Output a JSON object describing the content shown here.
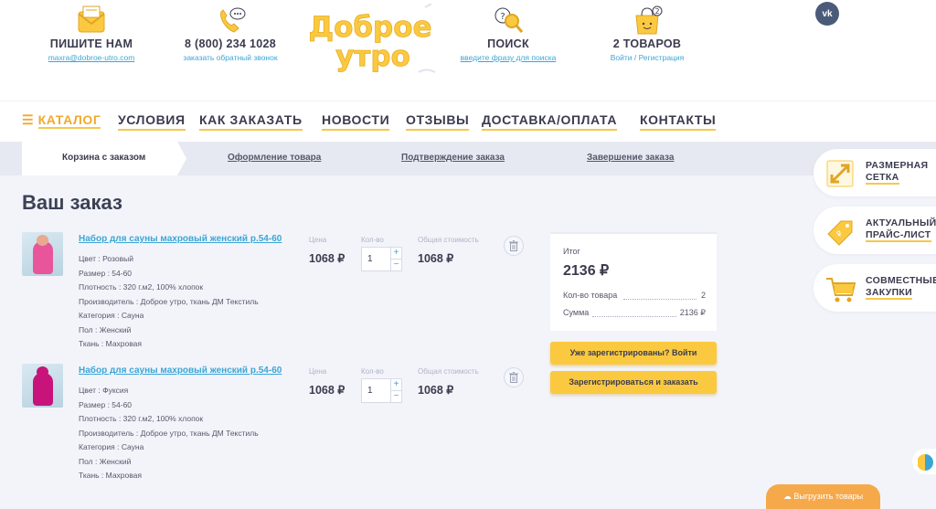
{
  "header": {
    "write": {
      "title": "ПИШИТЕ НАМ",
      "sub": "maxra@dobroe-utro.com",
      "icon": "envelope-icon"
    },
    "phone": {
      "title": "8 (800) 234 1028",
      "sub": "заказать обратный звонок",
      "icon": "phone-icon"
    },
    "logo": {
      "line1": "Доброе",
      "line2": "утро"
    },
    "search": {
      "title": "ПОИСК",
      "sub": "введите фразу для поиска",
      "icon": "search-icon"
    },
    "cart": {
      "title": "2 ТОВАРОВ",
      "sub": "Войти / Регистрация",
      "badge": "2",
      "icon": "cart-bag-icon"
    },
    "vk": "vk"
  },
  "nav": {
    "catalog": "КАТАЛОГ",
    "items": [
      "УСЛОВИЯ",
      "КАК ЗАКАЗАТЬ",
      "НОВОСТИ",
      "ОТЗЫВЫ",
      "ДОСТАВКА/ОПЛАТА",
      "КОНТАКТЫ"
    ]
  },
  "steps": [
    "Корзина с заказом",
    "Оформление товара",
    "Подтверждение заказа",
    "Завершение заказа"
  ],
  "page_title": "Ваш заказ",
  "columns": {
    "price": "Цена",
    "qty": "Кол-во",
    "total": "Общая стоимость"
  },
  "items": [
    {
      "name": "Набор для сауны махровый женский р.54-60",
      "props": [
        "Цвет : Розовый",
        "Размер : 54-60",
        "Плотность : 320 г.м2, 100% хлопок",
        "Производитель : Доброе утро, ткань ДМ Текстиль",
        "Категория : Сауна",
        "Пол : Женский",
        "Ткань : Махровая"
      ],
      "price": "1068 ₽",
      "qty": "1",
      "total": "1068 ₽",
      "color": "#e8559a"
    },
    {
      "name": "Набор для сауны махровый женский р.54-60",
      "props": [
        "Цвет : Фуксия",
        "Размер : 54-60",
        "Плотность : 320 г.м2, 100% хлопок",
        "Производитель : Доброе утро, ткань ДМ Текстиль",
        "Категория : Сауна",
        "Пол : Женский",
        "Ткань : Махровая"
      ],
      "price": "1068 ₽",
      "qty": "1",
      "total": "1068 ₽",
      "color": "#c8147a"
    }
  ],
  "summary": {
    "title": "Итог",
    "total": "2136 ₽",
    "count_label": "Кол-во товара",
    "count_value": "2",
    "sum_label": "Сумма",
    "sum_value": "2136 ₽"
  },
  "buttons": {
    "login": "Уже зарегистрированы? Войти",
    "register": "Зарегистрироваться и заказать"
  },
  "side": [
    {
      "line1": "РАЗМЕРНАЯ",
      "line2": "СЕТКА",
      "icon": "resize-arrows-icon"
    },
    {
      "line1": "АКТУАЛЬНЫЙ",
      "line2": "ПРАЙС-ЛИСТ",
      "icon": "price-tag-icon"
    },
    {
      "line1": "СОВМЕСТНЫЕ",
      "line2": "ЗАКУПКИ",
      "icon": "shopping-cart-icon"
    }
  ],
  "export": "Выгрузить товары",
  "colors": {
    "accent": "#fbc93f",
    "link": "#3ba6d6",
    "text": "#3b3b4f",
    "export": "#f6a94a"
  }
}
